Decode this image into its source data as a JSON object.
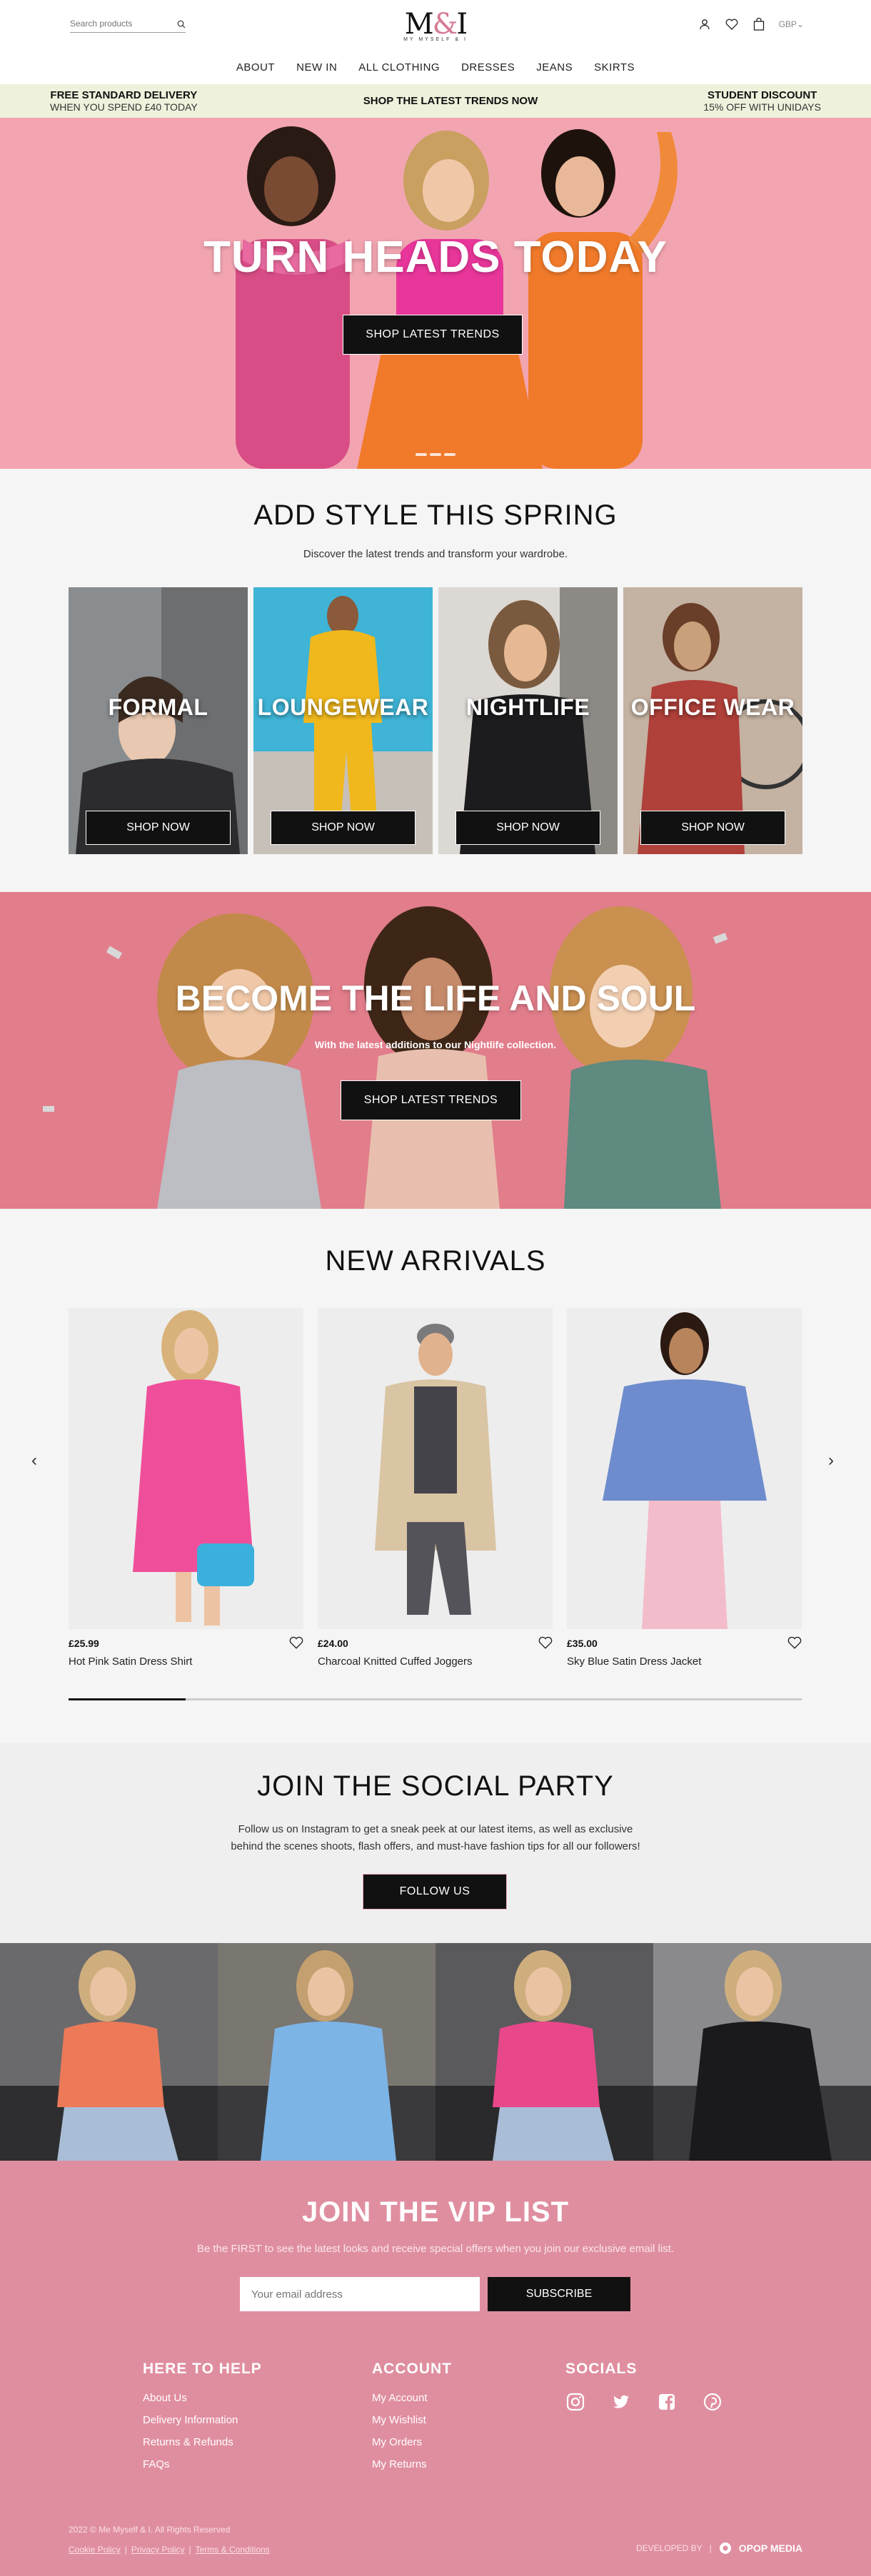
{
  "header": {
    "search_placeholder": "Search products",
    "logo_text": "M&I",
    "logo_sub": "MY MYSELF & I",
    "currency": "GBP"
  },
  "nav": [
    "ABOUT",
    "NEW IN",
    "ALL CLOTHING",
    "DRESSES",
    "JEANS",
    "SKIRTS"
  ],
  "promo": [
    {
      "title": "FREE STANDARD DELIVERY",
      "sub": "WHEN YOU SPEND £40 TODAY"
    },
    {
      "title": "SHOP THE LATEST TRENDS NOW",
      "sub": ""
    },
    {
      "title": "STUDENT DISCOUNT",
      "sub": "15% OFF WITH UNIDAYS"
    }
  ],
  "hero": {
    "title": "TURN HEADS TODAY",
    "button": "SHOP LATEST TRENDS"
  },
  "style_section": {
    "title": "ADD STYLE THIS SPRING",
    "subtitle": "Discover the latest trends and transform your wardrobe.",
    "categories": [
      {
        "label": "FORMAL",
        "button": "SHOP NOW"
      },
      {
        "label": "LOUNGEWEAR",
        "button": "SHOP NOW"
      },
      {
        "label": "NIGHTLIFE",
        "button": "SHOP NOW"
      },
      {
        "label": "OFFICE WEAR",
        "button": "SHOP NOW"
      }
    ]
  },
  "banner2": {
    "title": "BECOME THE LIFE AND SOUL",
    "subtitle": "With the latest additions to our Nightlife collection.",
    "button": "SHOP LATEST TRENDS"
  },
  "new_arrivals": {
    "title": "NEW ARRIVALS",
    "products": [
      {
        "price": "£25.99",
        "name": "Hot Pink Satin Dress Shirt"
      },
      {
        "price": "£24.00",
        "name": "Charcoal Knitted Cuffed Joggers"
      },
      {
        "price": "£35.00",
        "name": "Sky Blue Satin Dress Jacket"
      }
    ],
    "scroll_progress": 0.16
  },
  "social": {
    "title": "JOIN THE SOCIAL PARTY",
    "text_line1": "Follow us on Instagram to get a sneak peek at our latest items, as well as exclusive",
    "text_line2": "behind the scenes shoots, flash offers, and must-have fashion tips for all our followers!",
    "button": "FOLLOW US"
  },
  "vip": {
    "title": "JOIN THE VIP LIST",
    "text": "Be the FIRST to see the latest looks and receive special offers when you join our exclusive email list.",
    "email_placeholder": "Your email address",
    "button": "SUBSCRIBE"
  },
  "footer": {
    "help": {
      "title": "HERE TO HELP",
      "links": [
        "About Us",
        "Delivery Information",
        "Returns & Refunds",
        "FAQs"
      ]
    },
    "account": {
      "title": "ACCOUNT",
      "links": [
        "My Account",
        "My Wishlist",
        "My Orders",
        "My Returns"
      ]
    },
    "socials": {
      "title": "SOCIALS",
      "icons": [
        "instagram-icon",
        "twitter-icon",
        "facebook-icon",
        "pinterest-icon"
      ]
    },
    "copyright": "2022 © Me Myself & I. All Rights Reserved",
    "legal": [
      "Cookie Policy",
      "Privacy Policy",
      "Terms & Conditions"
    ],
    "developed_by": "DEVELOPED BY",
    "developer": "OPOP MEDIA"
  },
  "colors": {
    "pink": "#df8ea0",
    "promo_bg": "#eef2dc",
    "dark": "#111111"
  }
}
